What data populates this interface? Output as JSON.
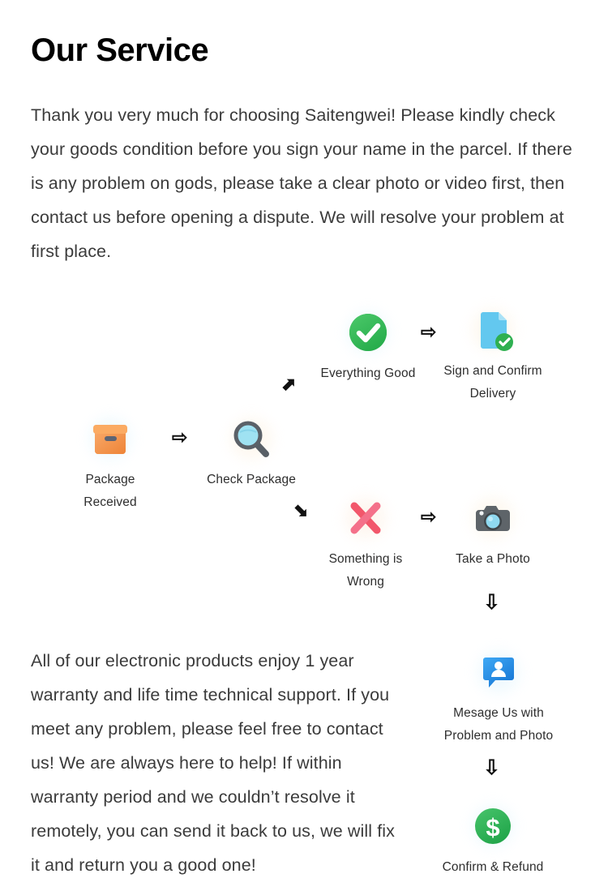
{
  "page": {
    "title": "Our Service",
    "paragraphs": {
      "intro": "Thank you very much for choosing Saitengwei! Please kindly check your goods condition before you sign your name in the parcel. If there is any problem on gods, please take a clear photo or video first, then contact us before opening a dispute. We will resolve your problem at first place.",
      "warranty": "All of our electronic products enjoy 1 year warranty and life time technical support. If you meet any problem, please feel free to contact us! We are always here to help! If within warranty period and we couldn’t resolve it remotely, you can send it back to us, we will fix it and return you a good one!"
    }
  },
  "flow": {
    "nodes": [
      {
        "id": "package-received",
        "icon": "package-box-icon",
        "label": "Package Received"
      },
      {
        "id": "check-package",
        "icon": "magnifier-icon",
        "label": "Check Package"
      },
      {
        "id": "everything-good",
        "icon": "green-check-circle-icon",
        "label": "Everything Good"
      },
      {
        "id": "sign-confirm",
        "icon": "document-check-icon",
        "label": "Sign and Confirm\nDelivery"
      },
      {
        "id": "something-wrong",
        "icon": "red-cross-icon",
        "label": "Something is\nWrong"
      },
      {
        "id": "take-a-photo",
        "icon": "camera-icon",
        "label": "Take a Photo"
      },
      {
        "id": "message-us",
        "icon": "message-person-icon",
        "label": "Mesage Us with\nProblem and Photo"
      },
      {
        "id": "confirm-refund",
        "icon": "dollar-circle-icon",
        "label": "Confirm & Refund"
      }
    ],
    "arrows": [
      {
        "id": "pkg-to-check",
        "glyph": "⇨",
        "direction": "right"
      },
      {
        "id": "check-to-good",
        "glyph": "⬈",
        "direction": "up-right"
      },
      {
        "id": "good-to-sign",
        "glyph": "⇨",
        "direction": "right"
      },
      {
        "id": "check-to-wrong",
        "glyph": "⬊",
        "direction": "down-right"
      },
      {
        "id": "wrong-to-photo",
        "glyph": "⇨",
        "direction": "right"
      },
      {
        "id": "photo-to-message",
        "glyph": "⇩",
        "direction": "down"
      },
      {
        "id": "message-to-refund",
        "glyph": "⇩",
        "direction": "down"
      }
    ]
  },
  "colors": {
    "green": "#35b857",
    "orange": "#f08a3c",
    "blue": "#5ec8f0",
    "red": "#f2566a",
    "message_blue": "#2196f3",
    "gray": "#5b6168",
    "text": "#3b3b3b"
  }
}
